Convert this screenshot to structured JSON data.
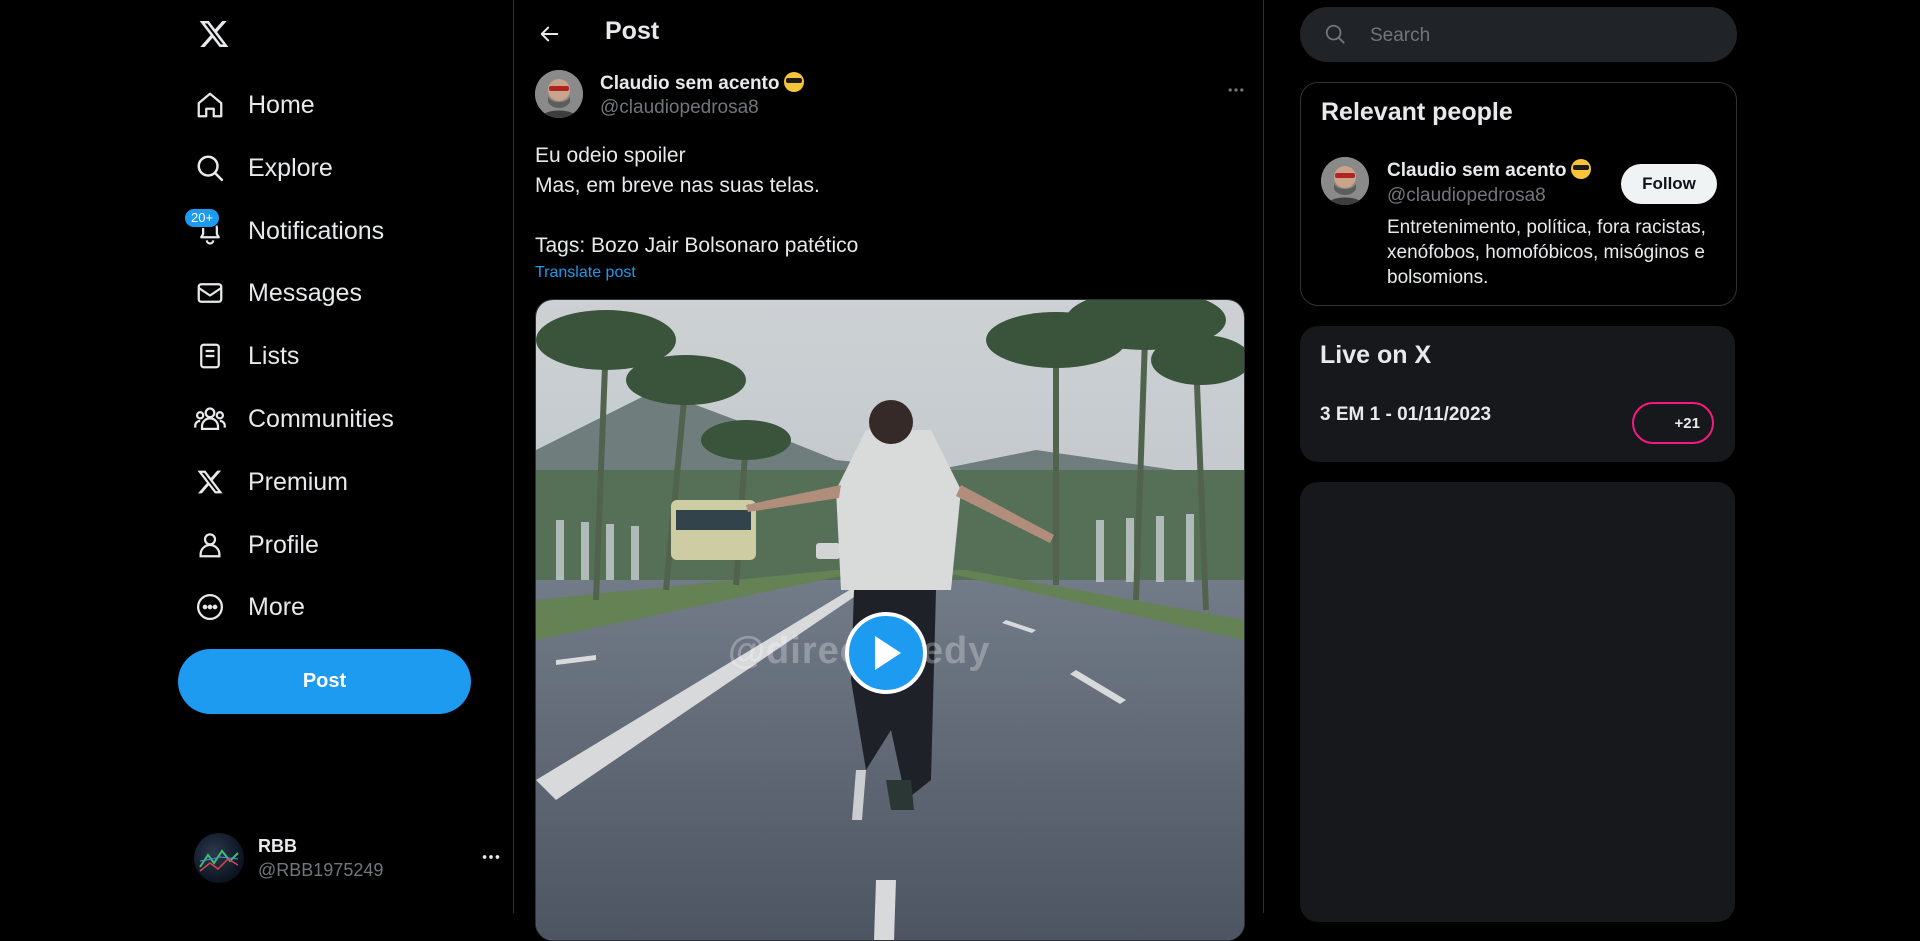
{
  "nav": {
    "items": [
      {
        "label": "Home",
        "icon": "home-icon"
      },
      {
        "label": "Explore",
        "icon": "search-icon"
      },
      {
        "label": "Notifications",
        "icon": "bell-icon",
        "badge": "20+"
      },
      {
        "label": "Messages",
        "icon": "envelope-icon"
      },
      {
        "label": "Lists",
        "icon": "list-icon"
      },
      {
        "label": "Communities",
        "icon": "people-icon"
      },
      {
        "label": "Premium",
        "icon": "x-logo-icon"
      },
      {
        "label": "Profile",
        "icon": "person-icon"
      },
      {
        "label": "More",
        "icon": "more-circle-icon"
      }
    ],
    "post_button": "Post",
    "account": {
      "name": "RBB",
      "handle": "@RBB1975249"
    }
  },
  "header": {
    "title": "Post"
  },
  "post": {
    "author_name": "Claudio sem acento",
    "author_handle": "@claudiopedrosa8",
    "text_lines": [
      "Eu odeio spoiler",
      "Mas, em breve nas suas telas.",
      "",
      "Tags: Bozo Jair Bolsonaro patético"
    ],
    "translate_label": "Translate post",
    "video_watermark": "@direct medy"
  },
  "search": {
    "placeholder": "Search"
  },
  "relevant": {
    "title": "Relevant people",
    "name": "Claudio sem acento",
    "handle": "@claudiopedrosa8",
    "follow_label": "Follow",
    "bio": "Entretenimento, política, fora racistas, xenófobos, homofóbicos, misóginos e bolsomions."
  },
  "live": {
    "title": "Live on X",
    "item": "3 EM 1 - 01/11/2023",
    "count": "+21"
  },
  "colors": {
    "accent": "#1d9bf0",
    "live": "#f91880",
    "bg": "#000000",
    "card": "#16181c"
  }
}
